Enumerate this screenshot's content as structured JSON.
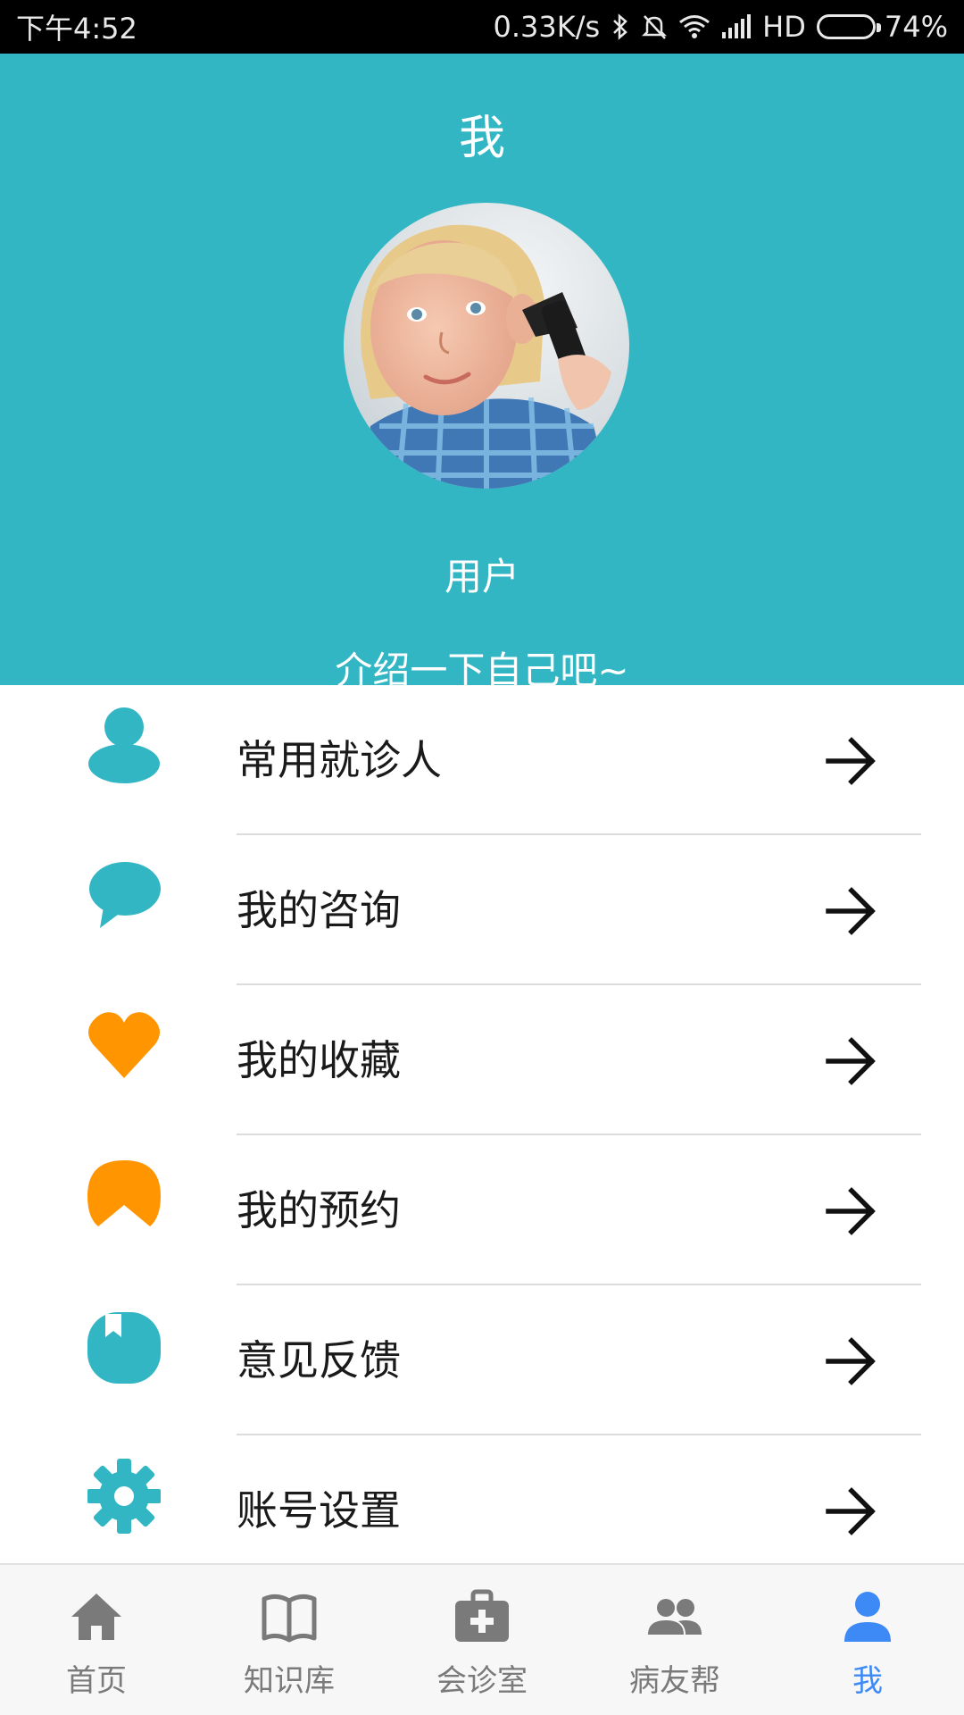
{
  "status_bar": {
    "time": "下午4:52",
    "network_speed": "0.33K/s",
    "hd_label": "HD",
    "battery_percent": "74%",
    "battery_level": 0.74
  },
  "header": {
    "title": "我",
    "user_name": "用户",
    "bio": "介绍一下自己吧~",
    "background_color": "#33b6c4"
  },
  "menu": {
    "items": [
      {
        "label": "常用就诊人",
        "icon": "person-icon",
        "color": "#33b6c4"
      },
      {
        "label": "我的咨询",
        "icon": "chat-bubble-icon",
        "color": "#33b6c4"
      },
      {
        "label": "我的收藏",
        "icon": "heart-icon",
        "color": "#ff9500"
      },
      {
        "label": "我的预约",
        "icon": "calendar-icon",
        "color": "#ff9500"
      },
      {
        "label": "意见反馈",
        "icon": "feedback-icon",
        "color": "#33b6c4"
      },
      {
        "label": "账号设置",
        "icon": "gear-icon",
        "color": "#33b6c4"
      }
    ]
  },
  "bottom_nav": {
    "items": [
      {
        "label": "首页",
        "icon": "home-icon"
      },
      {
        "label": "知识库",
        "icon": "book-icon"
      },
      {
        "label": "会诊室",
        "icon": "medical-kit-icon"
      },
      {
        "label": "病友帮",
        "icon": "group-icon"
      },
      {
        "label": "我",
        "icon": "user-icon",
        "active": true
      }
    ],
    "active_color": "#3d8af7",
    "inactive_color": "#7a7a7a"
  }
}
